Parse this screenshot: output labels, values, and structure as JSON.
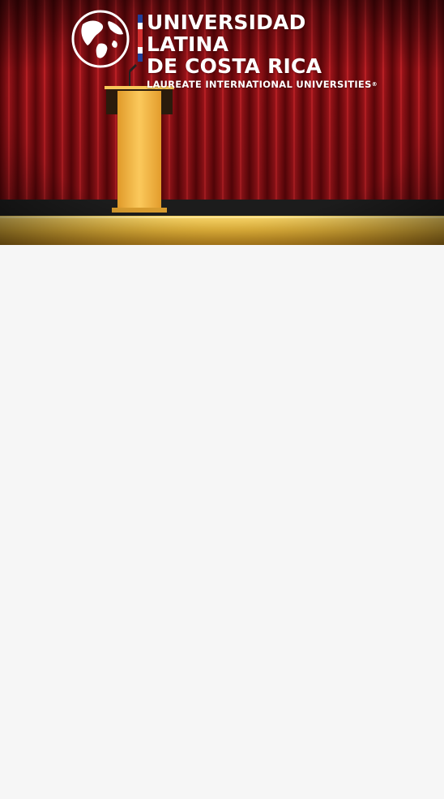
{
  "header": {
    "university_line1": "UNIVERSIDAD LATINA",
    "university_line2": "DE COSTA RICA",
    "university_tagline": "LAUREATE INTERNATIONAL UNIVERSITIES",
    "registered_mark": "®"
  },
  "hero": {
    "scene": "stage-with-podium-icon",
    "colors": {
      "curtain": "#a81a1f",
      "curtain_shadow": "#4b0406",
      "stage_floor": "#e8b63a",
      "podium": "#f2b648",
      "flag_red": "#d32f2f",
      "flag_blue": "#1f3f9a"
    }
  },
  "icons": {
    "logo": "globe-logo-icon",
    "flag": "costa-rica-flag-icon"
  }
}
